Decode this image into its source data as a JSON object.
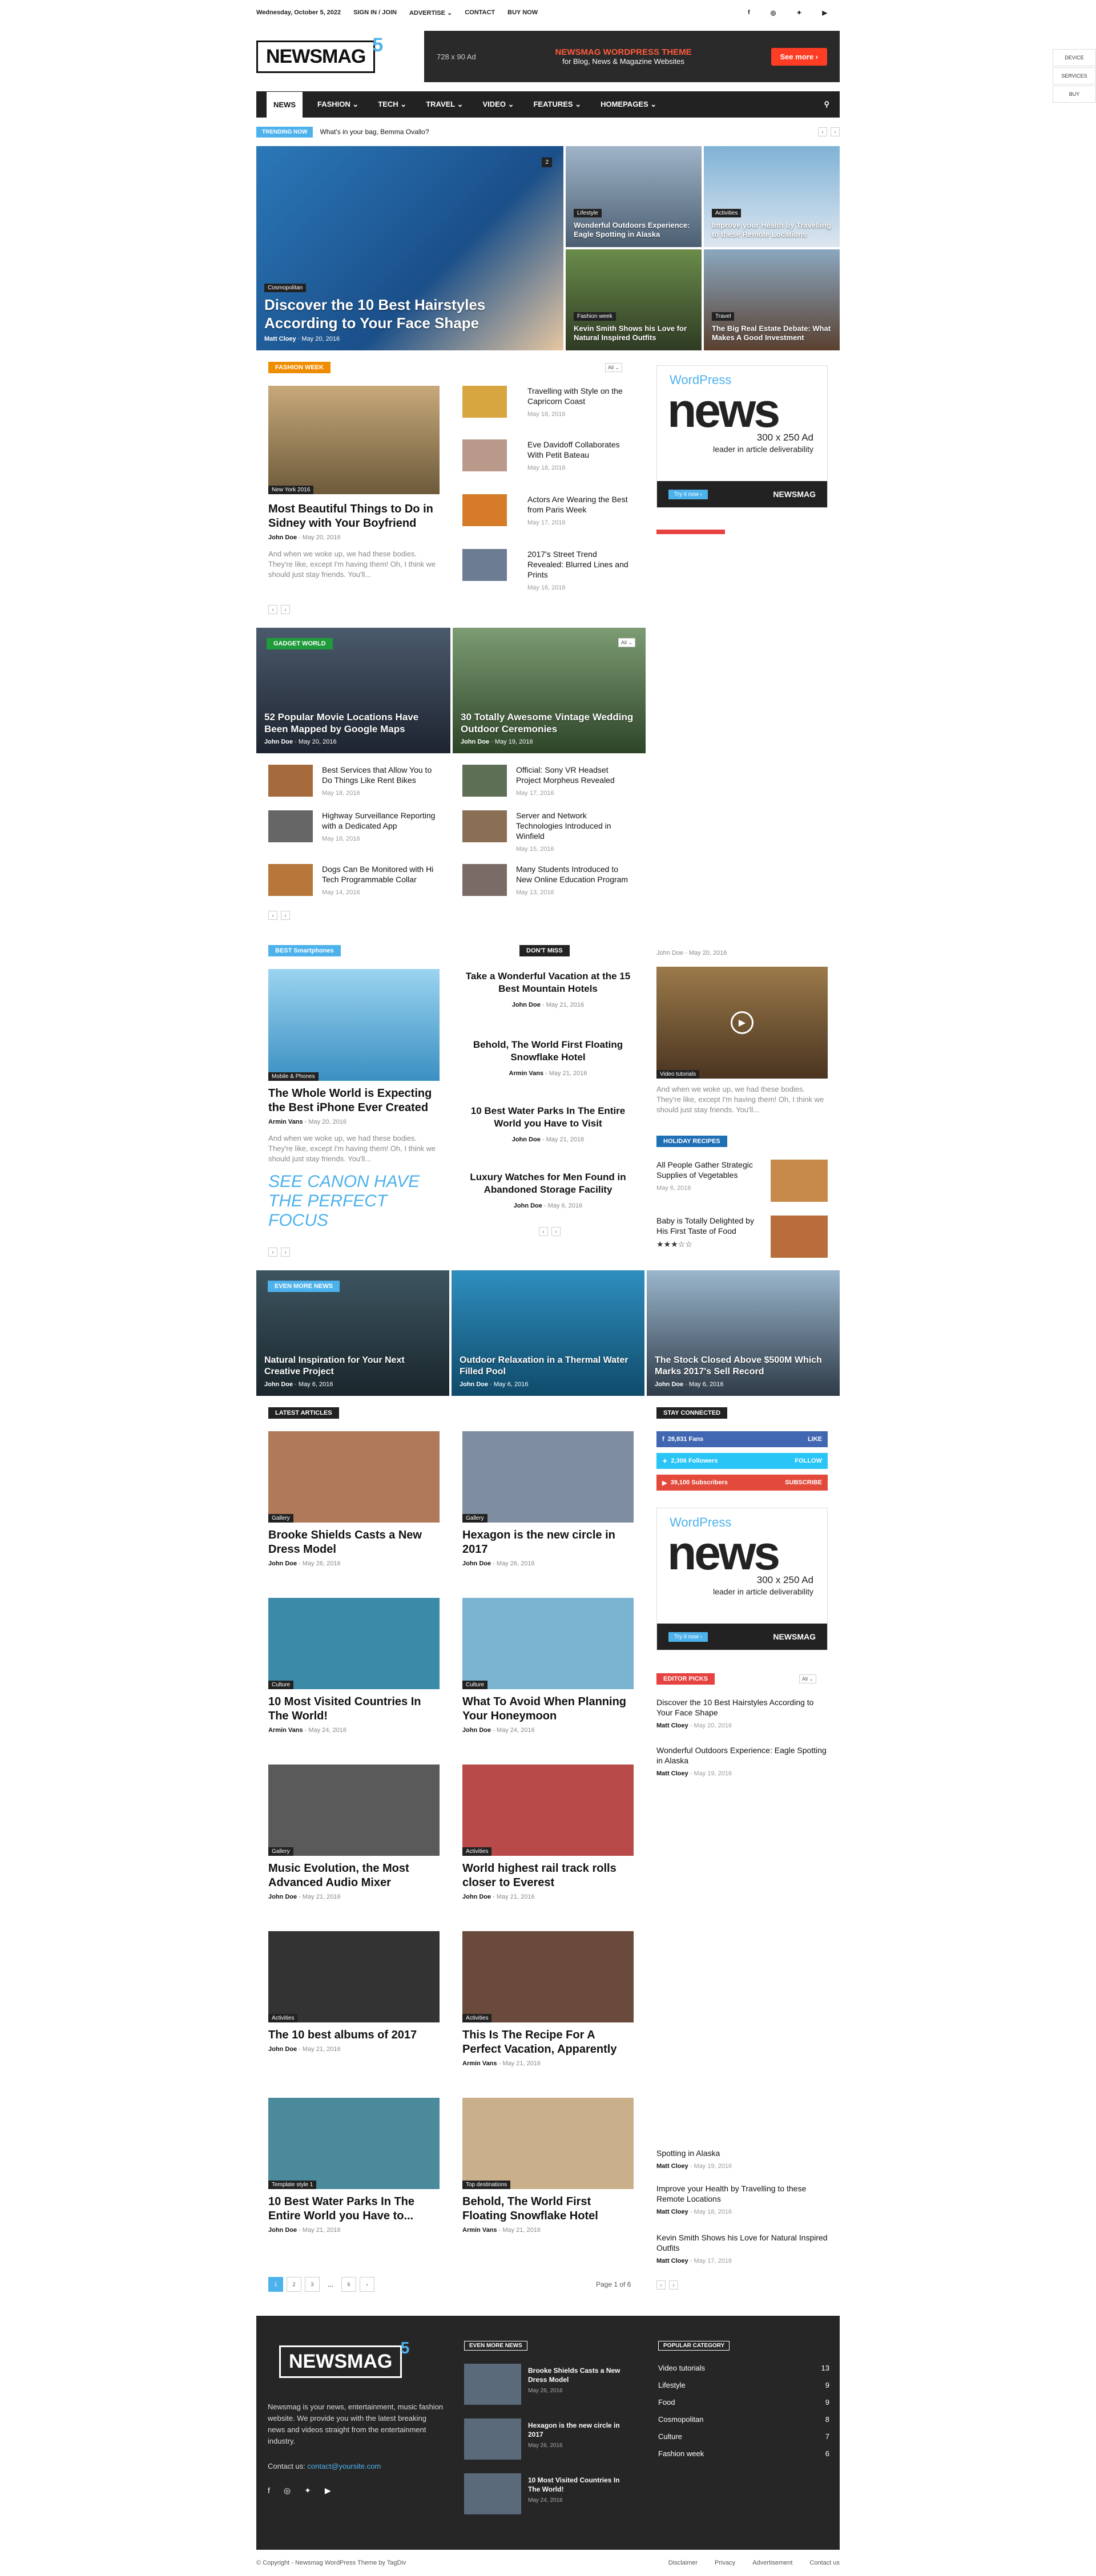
{
  "top": {
    "date": "Wednesday, October 5, 2022",
    "links": [
      "SIGN IN / JOIN",
      "ADVERTISE ⌄",
      "CONTACT",
      "BUY NOW"
    ]
  },
  "header": {
    "logo": "NEWSMAG",
    "logo_num": "5",
    "ad_left": "728 x 90 Ad",
    "ad_title": "NEWSMAG WORDPRESS THEME",
    "ad_sub": "for Blog, News & Magazine Websites",
    "ad_btn": "See more ›"
  },
  "nav": {
    "items": [
      "NEWS",
      "FASHION ⌄",
      "TECH ⌄",
      "TRAVEL ⌄",
      "VIDEO ⌄",
      "FEATURES ⌄",
      "HOMEPAGES ⌄"
    ]
  },
  "trending": {
    "tag": "TRENDING NOW",
    "text": "What's in your bag, Bemma Ovallo?"
  },
  "side_buttons": [
    "DEVICE",
    "SERVICES",
    "BUY"
  ],
  "hero": {
    "main": {
      "cat": "Cosmopolitan",
      "title": "Discover the 10 Best Hairstyles According to Your Face Shape",
      "author": "Matt Cloey",
      "date": "May 20, 2016",
      "badge": "2"
    },
    "tiles": [
      {
        "cat": "Lifestyle",
        "title": "Wonderful Outdoors Experience: Eagle Spotting in Alaska"
      },
      {
        "cat": "Activities",
        "title": "Improve your Health by Travelling to these Remote Locations"
      },
      {
        "cat": "Fashion week",
        "title": "Kevin Smith Shows his Love for Natural Inspired Outfits"
      },
      {
        "cat": "Travel",
        "title": "The Big Real Estate Debate: What Makes A Good Investment"
      }
    ]
  },
  "fashion": {
    "label": "FASHION WEEK",
    "all": "All ⌄",
    "main": {
      "cat": "New York 2016",
      "title": "Most Beautiful Things to Do in Sidney with Your Boyfriend",
      "author": "John Doe",
      "date": "May 20, 2016",
      "excerpt": "And when we woke up, we had these bodies. They're like, except I'm having them! Oh, I think we should just stay friends. You'll..."
    },
    "list": [
      {
        "t": "Travelling with Style on the Capricorn Coast",
        "d": "May 18, 2016"
      },
      {
        "t": "Eve Davidoff Collaborates With Petit Bateau",
        "d": "May 18, 2016"
      },
      {
        "t": "Actors Are Wearing the Best from Paris Week",
        "d": "May 17, 2016"
      },
      {
        "t": "2017's Street Trend Revealed: Blurred Lines and Prints",
        "d": "May 16, 2016"
      }
    ]
  },
  "gadget": {
    "label": "GADGET WORLD",
    "all": "All ⌄",
    "tiles": [
      {
        "title": "52 Popular Movie Locations Have Been Mapped by Google Maps",
        "author": "John Doe",
        "date": "May 20, 2016"
      },
      {
        "title": "30 Totally Awesome Vintage Wedding Outdoor Ceremonies",
        "author": "John Doe",
        "date": "May 19, 2016"
      }
    ],
    "list": [
      {
        "t": "Best Services that Allow You to Do Things Like Rent Bikes",
        "d": "May 18, 2016"
      },
      {
        "t": "Official: Sony VR Headset Project Morpheus Revealed",
        "d": "May 17, 2016"
      },
      {
        "t": "Highway Surveillance Reporting with a Dedicated App",
        "d": "May 16, 2016"
      },
      {
        "t": "Server and Network Technologies Introduced in Winfield",
        "d": "May 15, 2016"
      },
      {
        "t": "Dogs Can Be Monitored with Hi Tech Programmable Collar",
        "d": "May 14, 2016"
      },
      {
        "t": "Many Students Introduced to New Online Education Program",
        "d": "May 13, 2016"
      }
    ]
  },
  "smart": {
    "label": "BEST Smartphones",
    "cat": "Mobile & Phones",
    "title": "The Whole World is Expecting the Best iPhone Ever Created",
    "author": "Armin Vans",
    "date": "May 20, 2016",
    "excerpt": "And when we woke up, we had these bodies. They're like, except I'm having them! Oh, I think we should just stay friends. You'll...",
    "quote": "SEE CANON HAVE THE PERFECT FOCUS"
  },
  "dontmiss": {
    "label": "DON'T MISS",
    "items": [
      {
        "t": "Take a Wonderful Vacation at the 15 Best Mountain Hotels",
        "a": "John Doe",
        "d": "May 21, 2016"
      },
      {
        "t": "Behold, The World First Floating Snowflake Hotel",
        "a": "Armin Vans",
        "d": "May 21, 2016"
      },
      {
        "t": "10 Best Water Parks In The Entire World you Have to Visit",
        "a": "John Doe",
        "d": "May 21, 2016"
      },
      {
        "t": "Luxury Watches for Men Found in Abandoned Storage Facility",
        "a": "John Doe",
        "d": "May 6, 2016"
      }
    ]
  },
  "video": {
    "meta": "John Doe - May 20, 2016",
    "cat": "Video tutorials",
    "excerpt": "And when we woke up, we had these bodies. They're like, except I'm having them! Oh, I think we should just stay friends. You'll..."
  },
  "recipes": {
    "label": "HOLIDAY RECIPES",
    "items": [
      {
        "t": "All People Gather Strategic Supplies of Vegetables",
        "d": "May 6, 2016"
      },
      {
        "t": "Baby is Totally Delighted by His First Taste of Food",
        "d": "★★★☆☆"
      }
    ]
  },
  "moreNews": {
    "label": "EVEN MORE NEWS",
    "tiles": [
      {
        "t": "Natural Inspiration for Your Next Creative Project",
        "a": "John Doe",
        "d": "May 6, 2016"
      },
      {
        "t": "Outdoor Relaxation in a Thermal Water Filled Pool",
        "a": "John Doe",
        "d": "May 6, 2016"
      },
      {
        "t": "The Stock Closed Above $500M Which Marks 2017's Sell Record",
        "a": "John Doe",
        "d": "May 6, 2016"
      }
    ]
  },
  "latest": {
    "label": "LATEST ARTICLES",
    "items": [
      {
        "cat": "Gallery",
        "t": "Brooke Shields Casts a New Dress Model",
        "a": "John Doe",
        "d": "May 26, 2016"
      },
      {
        "cat": "Gallery",
        "t": "Hexagon is the new circle in 2017",
        "a": "John Doe",
        "d": "May 26, 2016"
      },
      {
        "cat": "Culture",
        "t": "10 Most Visited Countries In The World!",
        "a": "Armin Vans",
        "d": "May 24, 2016"
      },
      {
        "cat": "Culture",
        "t": "What To Avoid When Planning Your Honeymoon",
        "a": "John Doe",
        "d": "May 24, 2016"
      },
      {
        "cat": "Gallery",
        "t": "Music Evolution, the Most Advanced Audio Mixer",
        "a": "John Doe",
        "d": "May 21, 2016"
      },
      {
        "cat": "Activities",
        "t": "World highest rail track rolls closer to Everest",
        "a": "John Doe",
        "d": "May 21, 2016"
      },
      {
        "cat": "Activities",
        "t": "The 10 best albums of 2017",
        "a": "John Doe",
        "d": "May 21, 2016"
      },
      {
        "cat": "Activities",
        "t": "This Is The Recipe For A Perfect Vacation, Apparently",
        "a": "Armin Vans",
        "d": "May 21, 2016"
      },
      {
        "cat": "Template style 1",
        "t": "10 Best Water Parks In The Entire World you Have to...",
        "a": "John Doe",
        "d": "May 21, 2016"
      },
      {
        "cat": "Top destinations",
        "t": "Behold, The World First Floating Snowflake Hotel",
        "a": "Armin Vans",
        "d": "May 21, 2016"
      }
    ],
    "pages": [
      "1",
      "2",
      "3",
      "...",
      "6",
      "›"
    ],
    "pageof": "Page 1 of 6"
  },
  "connected": {
    "label": "STAY CONNECTED",
    "rows": [
      {
        "n": "28,831",
        "l": "Fans",
        "b": "LIKE"
      },
      {
        "n": "2,306",
        "l": "Followers",
        "b": "FOLLOW"
      },
      {
        "n": "39,100",
        "l": "Subscribers",
        "b": "SUBSCRIBE"
      }
    ]
  },
  "ad300": {
    "wp": "WordPress",
    "news": "news",
    "size": "300 x 250 Ad",
    "sub": "leader in article deliverability",
    "btn": "Try it now ›",
    "brand": "NEWSMAG"
  },
  "editor": {
    "label": "EDITOR PICKS",
    "all": "All ⌄",
    "items": [
      {
        "t": "Discover the 10 Best Hairstyles According to Your Face Shape",
        "a": "Matt Cloey",
        "d": "May 20, 2016"
      },
      {
        "t": "Wonderful Outdoors Experience: Eagle Spotting in Alaska",
        "a": "Matt Cloey",
        "d": "May 19, 2016"
      }
    ],
    "lower": [
      {
        "t": "Spotting in Alaska",
        "a": "Matt Cloey",
        "d": "May 19, 2016"
      },
      {
        "t": "Improve your Health by Travelling to these Remote Locations",
        "a": "Matt Cloey",
        "d": "May 18, 2016"
      },
      {
        "t": "Kevin Smith Shows his Love for Natural Inspired Outfits",
        "a": "Matt Cloey",
        "d": "May 17, 2016"
      }
    ]
  },
  "footer": {
    "about": "Newsmag is your news, entertainment, music fashion website. We provide you with the latest breaking news and videos straight from the entertainment industry.",
    "contact_label": "Contact us:",
    "contact_email": "contact@yoursite.com",
    "even_label": "EVEN MORE NEWS",
    "even": [
      {
        "t": "Brooke Shields Casts a New Dress Model",
        "d": "May 26, 2016"
      },
      {
        "t": "Hexagon is the new circle in 2017",
        "d": "May 26, 2016"
      },
      {
        "t": "10 Most Visited Countries In The World!",
        "d": "May 24, 2016"
      }
    ],
    "pop_label": "POPULAR CATEGORY",
    "pop": [
      {
        "n": "Video tutorials",
        "c": "13"
      },
      {
        "n": "Lifestyle",
        "c": "9"
      },
      {
        "n": "Food",
        "c": "9"
      },
      {
        "n": "Cosmopolitan",
        "c": "8"
      },
      {
        "n": "Culture",
        "c": "7"
      },
      {
        "n": "Fashion week",
        "c": "6"
      }
    ]
  },
  "bottom": {
    "copy": "© Copyright - Newsmag WordPress Theme by TagDiv",
    "links": [
      "Disclaimer",
      "Privacy",
      "Advertisement",
      "Contact us"
    ]
  },
  "colors": {
    "accent": "#4db2ec",
    "orange": "#f08c00",
    "red": "#e64240",
    "green": "#1e9b3b",
    "dark": "#222222"
  }
}
